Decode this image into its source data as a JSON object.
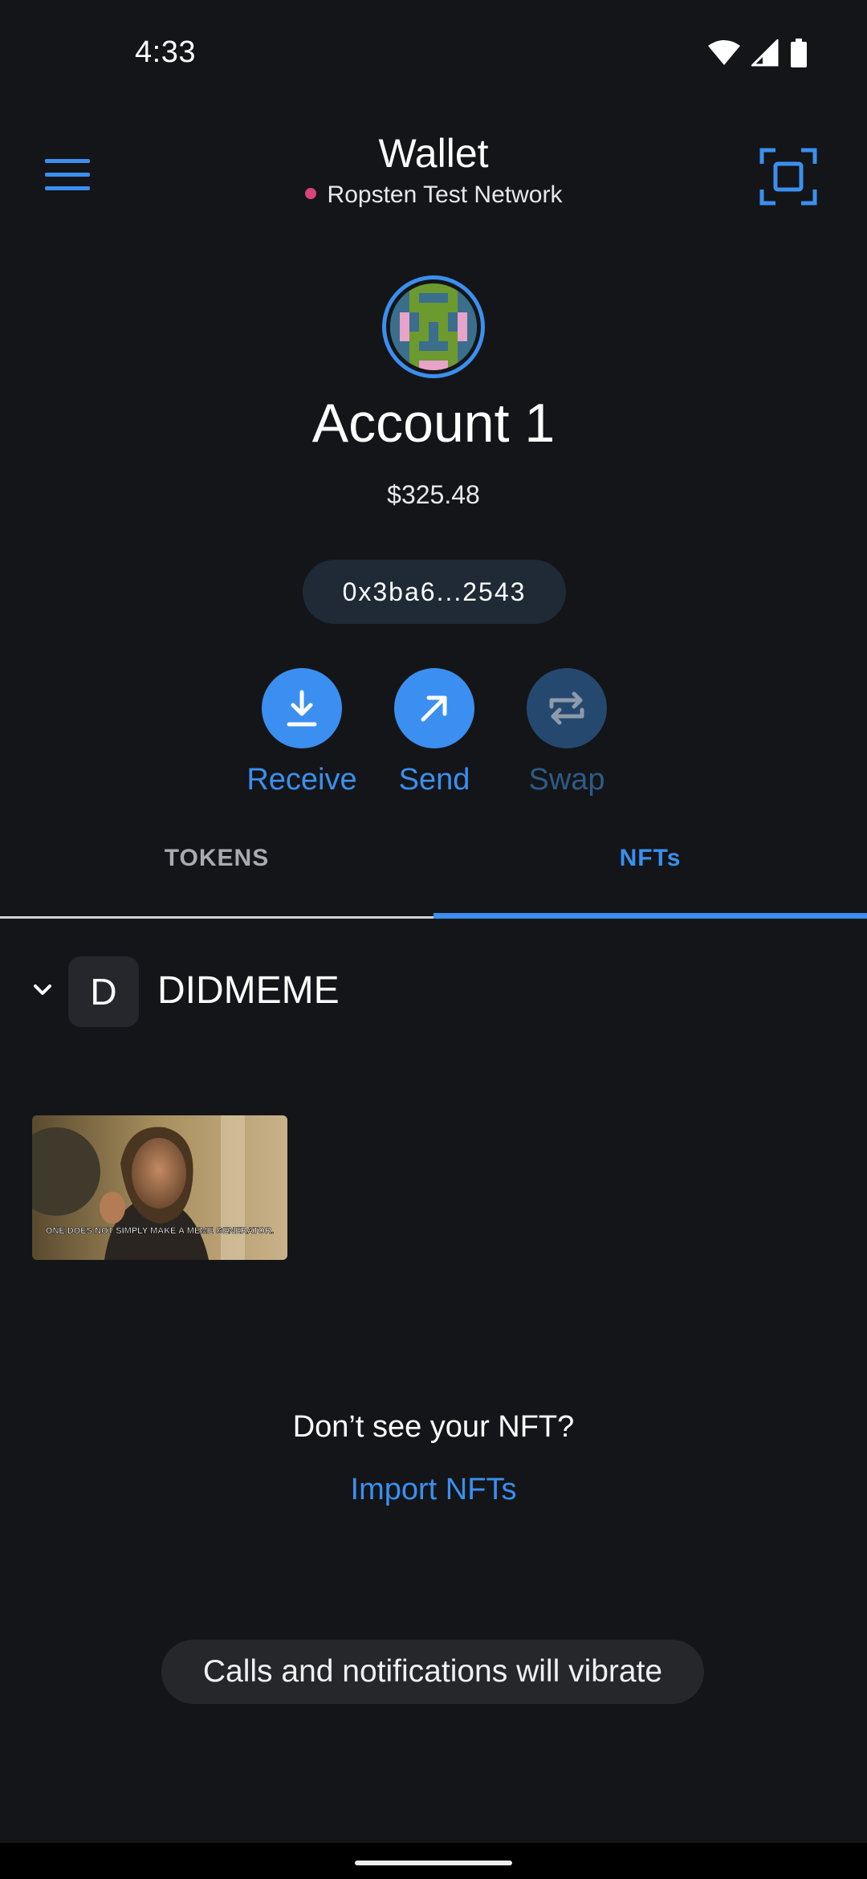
{
  "status_bar": {
    "time": "4:33",
    "icons": [
      "wifi-icon",
      "signal-icon",
      "battery-icon"
    ]
  },
  "header": {
    "title": "Wallet",
    "network": "Ropsten Test Network",
    "network_dot_color": "#d8457a",
    "menu_icon": "hamburger-menu-icon",
    "scan_icon": "scan-qr-icon"
  },
  "account": {
    "name": "Account 1",
    "balance": "$325.48",
    "address": "0x3ba6...2543"
  },
  "actions": [
    {
      "label": "Receive",
      "icon": "download-icon",
      "enabled": true
    },
    {
      "label": "Send",
      "icon": "arrow-up-right-icon",
      "enabled": true
    },
    {
      "label": "Swap",
      "icon": "swap-icon",
      "enabled": false
    }
  ],
  "tabs": [
    {
      "label": "TOKENS",
      "active": false
    },
    {
      "label": "NFTs",
      "active": true
    }
  ],
  "collection": {
    "badge": "D",
    "name": "DIDMEME",
    "items": [
      {
        "caption": "ONE DOES NOT SIMPLY MAKE A MEME GENERATOR."
      }
    ]
  },
  "empty_prompt": {
    "question": "Don’t see your NFT?",
    "link": "Import NFTs"
  },
  "toast": {
    "text": "Calls and notifications will vibrate"
  },
  "colors": {
    "accent": "#3b8ff0",
    "background": "#141518",
    "pill": "#1f2a36"
  }
}
